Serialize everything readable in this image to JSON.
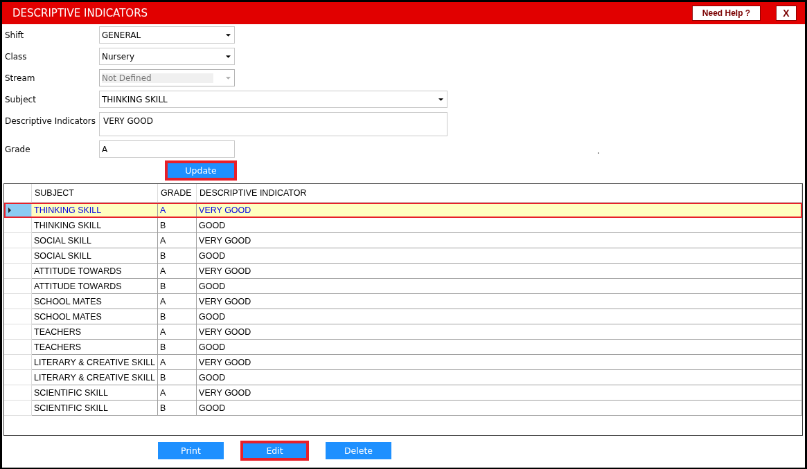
{
  "window": {
    "title": "DESCRIPTIVE INDICATORS",
    "help_button": "Need Help ?",
    "close_button": "X"
  },
  "form": {
    "fields": [
      {
        "label": "Shift",
        "kind": "dropdown",
        "value": "GENERAL",
        "disabled": false,
        "wide": false
      },
      {
        "label": "Class",
        "kind": "dropdown",
        "value": "Nursery",
        "disabled": false,
        "wide": false
      },
      {
        "label": "Stream",
        "kind": "dropdown",
        "value": "Not Defined",
        "disabled": true,
        "wide": false
      },
      {
        "label": "Subject",
        "kind": "dropdown",
        "value": "THINKING SKILL",
        "disabled": false,
        "wide": true
      },
      {
        "label": "Descriptive Indicators",
        "kind": "textarea",
        "value": "VERY GOOD",
        "disabled": false,
        "wide": true
      },
      {
        "label": "Grade",
        "kind": "text",
        "value": "A",
        "disabled": false,
        "wide": false
      }
    ],
    "note": ".",
    "update_button": {
      "label": "Update",
      "highlighted": true
    }
  },
  "table": {
    "columns": [
      "SUBJECT",
      "GRADE",
      "DESCRIPTIVE INDICATOR"
    ],
    "rows": [
      {
        "cells": [
          "THINKING SKILL",
          "A",
          "VERY GOOD"
        ],
        "selected": true
      },
      {
        "cells": [
          "THINKING SKILL",
          "B",
          "GOOD"
        ],
        "selected": false
      },
      {
        "cells": [
          "SOCIAL SKILL",
          "A",
          "VERY GOOD"
        ],
        "selected": false
      },
      {
        "cells": [
          "SOCIAL SKILL",
          "B",
          "GOOD"
        ],
        "selected": false
      },
      {
        "cells": [
          "ATTITUDE TOWARDS",
          "A",
          "VERY GOOD"
        ],
        "selected": false
      },
      {
        "cells": [
          "ATTITUDE TOWARDS",
          "B",
          "GOOD"
        ],
        "selected": false
      },
      {
        "cells": [
          "SCHOOL MATES",
          "A",
          "VERY GOOD"
        ],
        "selected": false
      },
      {
        "cells": [
          "SCHOOL MATES",
          "B",
          "GOOD"
        ],
        "selected": false
      },
      {
        "cells": [
          "TEACHERS",
          "A",
          "VERY GOOD"
        ],
        "selected": false
      },
      {
        "cells": [
          "TEACHERS",
          "B",
          "GOOD"
        ],
        "selected": false
      },
      {
        "cells": [
          "LITERARY & CREATIVE SKILL",
          "A",
          "VERY GOOD"
        ],
        "selected": false
      },
      {
        "cells": [
          "LITERARY & CREATIVE SKILL",
          "B",
          "GOOD"
        ],
        "selected": false
      },
      {
        "cells": [
          "SCIENTIFIC SKILL",
          "A",
          "VERY GOOD"
        ],
        "selected": false
      },
      {
        "cells": [
          "SCIENTIFIC SKILL",
          "B",
          "GOOD"
        ],
        "selected": false
      }
    ]
  },
  "buttons": [
    {
      "label": "Print",
      "highlighted": false
    },
    {
      "label": "Edit",
      "highlighted": true
    },
    {
      "label": "Delete",
      "highlighted": false
    }
  ]
}
